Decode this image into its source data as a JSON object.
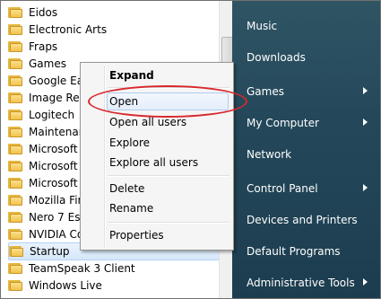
{
  "programs": {
    "items": [
      {
        "label": "Eidos"
      },
      {
        "label": "Electronic Arts"
      },
      {
        "label": "Fraps"
      },
      {
        "label": "Games"
      },
      {
        "label": "Google Ea"
      },
      {
        "label": "Image Rev"
      },
      {
        "label": "Logitech"
      },
      {
        "label": "Maintenar"
      },
      {
        "label": "Microsoft"
      },
      {
        "label": "Microsoft"
      },
      {
        "label": "Microsoft"
      },
      {
        "label": "Mozilla Fir"
      },
      {
        "label": "Nero 7 Ess"
      },
      {
        "label": "NVIDIA Co"
      },
      {
        "label": "Startup"
      },
      {
        "label": "TeamSpeak 3 Client"
      },
      {
        "label": "Windows Live"
      }
    ]
  },
  "start_menu": {
    "items": [
      {
        "label": "Music"
      },
      {
        "label": "Downloads"
      },
      {
        "label": "Games"
      },
      {
        "label": "My Computer"
      },
      {
        "label": "Network"
      },
      {
        "label": "Control Panel"
      },
      {
        "label": "Devices and Printers"
      },
      {
        "label": "Default Programs"
      },
      {
        "label": "Administrative Tools"
      }
    ]
  },
  "context_menu": {
    "expand": "Expand",
    "open": "Open",
    "open_all_users": "Open all users",
    "explore": "Explore",
    "explore_all_users": "Explore all users",
    "delete": "Delete",
    "rename": "Rename",
    "properties": "Properties"
  },
  "colors": {
    "annotation": "#d8282c",
    "right_pane": "#24485a"
  }
}
